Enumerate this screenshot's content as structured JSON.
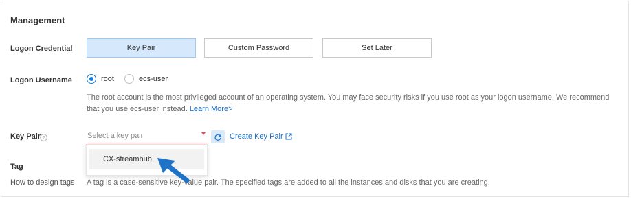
{
  "section": {
    "title": "Management"
  },
  "logon_credential": {
    "label": "Logon Credential",
    "options": [
      "Key Pair",
      "Custom Password",
      "Set Later"
    ],
    "selected": "Key Pair"
  },
  "logon_username": {
    "label": "Logon Username",
    "options": [
      "root",
      "ecs-user"
    ],
    "selected": "root",
    "description": "The root account is the most privileged account of an operating system. You may face security risks if you use root as your logon username. We recommend that you use ecs-user instead.",
    "learn_more": "Learn More>"
  },
  "key_pair": {
    "label": "Key Pair",
    "placeholder": "Select a key pair",
    "create_link": "Create Key Pair",
    "dropdown_options": [
      "CX-streamhub"
    ]
  },
  "tag": {
    "label": "Tag",
    "sub_label": "How to design tags",
    "description": "A tag is a case-sensitive key-value pair. The specified tags are added to all the instances and disks that you are creating."
  },
  "colors": {
    "accent": "#1a7cd6",
    "selected_bg": "#d6e8fb",
    "error": "#e34d59",
    "annotation_arrow": "#1f74c8"
  },
  "icons": [
    "help-icon",
    "refresh-icon",
    "external-link-icon",
    "dropdown-arrow-icon",
    "pointer-arrow-icon"
  ]
}
